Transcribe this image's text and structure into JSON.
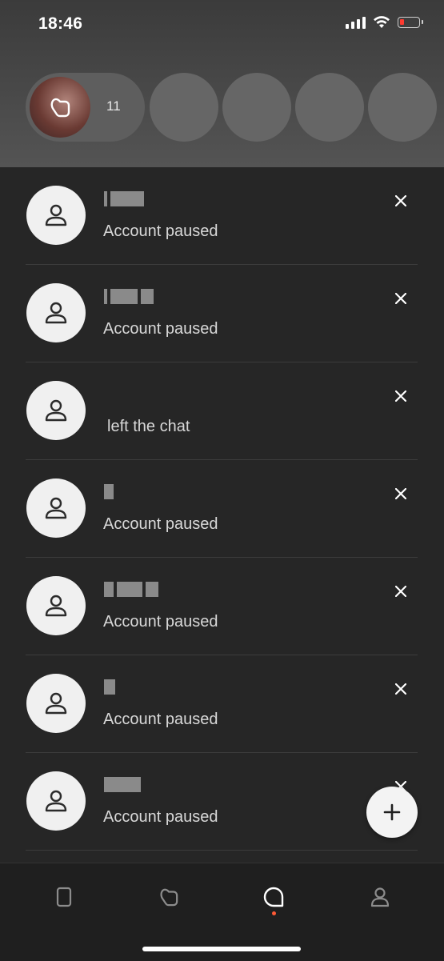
{
  "status_bar": {
    "time": "18:46",
    "battery_color": "#ff3b30"
  },
  "likes": {
    "count": "11",
    "icon": "heart-outline-icon"
  },
  "matches_placeholders": 4,
  "chats": [
    {
      "name_redacted": true,
      "status": "Account paused"
    },
    {
      "name_redacted": true,
      "status": "Account paused"
    },
    {
      "name_redacted": true,
      "status": "left the chat"
    },
    {
      "name_redacted": true,
      "status": "Account paused"
    },
    {
      "name_redacted": true,
      "status": "Account paused"
    },
    {
      "name_redacted": true,
      "status": "Account paused"
    },
    {
      "name_redacted": true,
      "status": "Account paused"
    }
  ],
  "fab": {
    "icon": "plus-icon"
  },
  "bottom_nav": {
    "items": [
      {
        "icon": "phone-card-icon",
        "active": false
      },
      {
        "icon": "heart-outline-icon",
        "active": false
      },
      {
        "icon": "chat-bubble-icon",
        "active": true
      },
      {
        "icon": "profile-icon",
        "active": false
      }
    ],
    "active_dot_color": "#ff5a36"
  }
}
